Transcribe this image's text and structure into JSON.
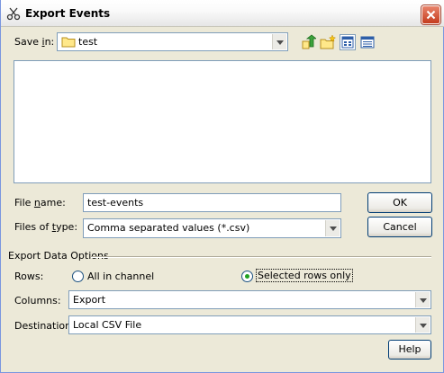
{
  "window": {
    "title": "Export Events"
  },
  "save_in": {
    "label_pre": "Save ",
    "label_key": "i",
    "label_post": "n:",
    "value": "test"
  },
  "file_name": {
    "label_pre": "File ",
    "label_key": "n",
    "label_post": "ame:",
    "value": "test-events"
  },
  "files_of_type": {
    "label_pre": "Files of ",
    "label_key": "t",
    "label_post": "ype:",
    "value": "Comma separated values (*.csv)"
  },
  "buttons": {
    "ok": "OK",
    "cancel": "Cancel",
    "help": "Help"
  },
  "export_options": {
    "section_title": "Export Data Options",
    "rows_label": "Rows:",
    "rows_options": [
      {
        "label": "All in channel",
        "selected": false
      },
      {
        "label": "Selected rows only",
        "selected": true
      }
    ],
    "columns_label": "Columns:",
    "columns_value": "Export",
    "destination_label": "Destination:",
    "destination_value": "Local CSV File"
  },
  "icons": {
    "app": "scissors-icon",
    "folder": "folder-icon",
    "up": "up-one-level-icon",
    "new_folder": "new-folder-icon",
    "list_view": "list-view-icon",
    "details_view": "details-view-icon",
    "close": "close-icon"
  },
  "colors": {
    "dialog_bg": "#ECE9D8",
    "field_border": "#7F9DB9",
    "close_button": "#C43C1E",
    "radio_dot": "#21A121"
  }
}
